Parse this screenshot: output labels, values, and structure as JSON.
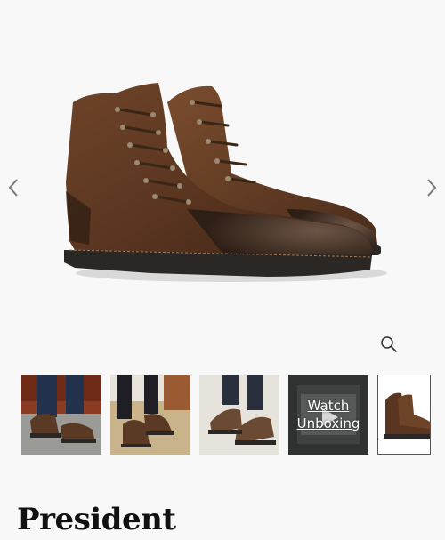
{
  "gallery": {
    "prev_icon": "chevron-left-icon",
    "next_icon": "chevron-right-icon",
    "zoom_icon": "magnifier-icon",
    "product_image": "dark brown suede lace-up boots"
  },
  "thumbnails": [
    {
      "name": "lifestyle-photo-brick-step"
    },
    {
      "name": "lifestyle-photo-lacing-on-rug"
    },
    {
      "name": "lifestyle-photo-standing"
    },
    {
      "name": "video-thumbnail",
      "line1": "Watch",
      "line2": "Unboxing",
      "icon": "play-icon"
    },
    {
      "name": "product-photo-side-angle"
    }
  ],
  "product": {
    "title": "President"
  },
  "colors": {
    "background": "#f8f8f8",
    "boot_brown": "#5a3a24",
    "sole": "#2b2724"
  }
}
